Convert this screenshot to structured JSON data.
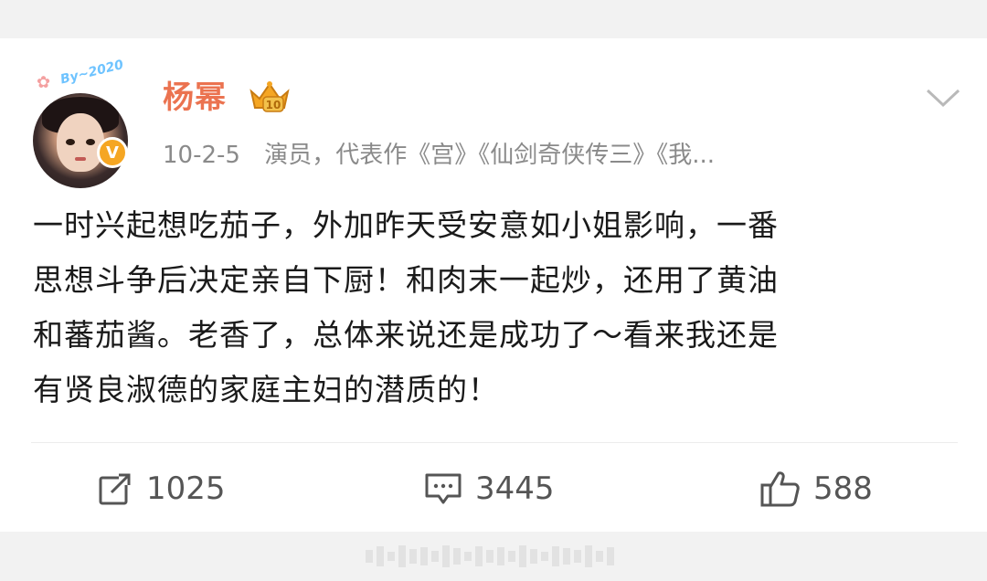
{
  "post": {
    "username": "杨幂",
    "date": "10-2-5",
    "bio": "演员，代表作《宫》《仙剑奇侠传三》《我...",
    "verified_mark": "V",
    "avatar_sticker_text": "By~2020",
    "content_lines": [
      "一时兴起想吃茄子，外加昨天受安意如小姐影响，一番",
      "思想斗争后决定亲自下厨！和肉末一起炒，还用了黄油",
      "和蕃茄酱。老香了，总体来说还是成功了～看来我还是",
      "有贤良淑德的家庭主妇的潜质的！"
    ]
  },
  "actions": {
    "repost_count": "1025",
    "comment_count": "3445",
    "like_count": "588"
  },
  "icons": {
    "repost": "repost-icon",
    "comment": "comment-icon",
    "like": "thumbs-up-icon",
    "menu": "chevron-down-icon",
    "badge": "crown-icon"
  },
  "colors": {
    "username": "#eb7350",
    "meta_text": "#8a8a8a",
    "content_text": "#1a1a1a",
    "verified": "#f5a623"
  }
}
